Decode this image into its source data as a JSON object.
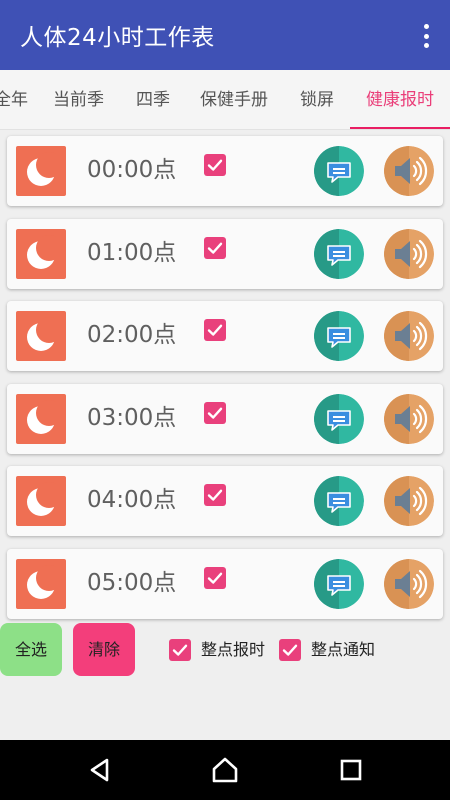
{
  "app_bar": {
    "title": "人体24小时工作表",
    "overflow_icon": "more-vert-icon",
    "background": "#3f51b5"
  },
  "tabs": [
    {
      "label": "全年",
      "active": false
    },
    {
      "label": "当前季",
      "active": false
    },
    {
      "label": "四季",
      "active": false
    },
    {
      "label": "保健手册",
      "active": false
    },
    {
      "label": "锁屏",
      "active": false
    },
    {
      "label": "健康报时",
      "active": true
    }
  ],
  "accent_color": "#e91e63",
  "alarms": [
    {
      "time": "00:00点",
      "checked": true,
      "icon": "moon-icon",
      "notify_icon": "message-icon",
      "sound_icon": "speaker-icon"
    },
    {
      "time": "01:00点",
      "checked": true,
      "icon": "moon-icon",
      "notify_icon": "message-icon",
      "sound_icon": "speaker-icon"
    },
    {
      "time": "02:00点",
      "checked": true,
      "icon": "moon-icon",
      "notify_icon": "message-icon",
      "sound_icon": "speaker-icon"
    },
    {
      "time": "03:00点",
      "checked": true,
      "icon": "moon-icon",
      "notify_icon": "message-icon",
      "sound_icon": "speaker-icon"
    },
    {
      "time": "04:00点",
      "checked": true,
      "icon": "moon-icon",
      "notify_icon": "message-icon",
      "sound_icon": "speaker-icon"
    },
    {
      "time": "05:00点",
      "checked": true,
      "icon": "moon-icon",
      "notify_icon": "message-icon",
      "sound_icon": "speaker-icon"
    }
  ],
  "bottom": {
    "select_all_label": "全选",
    "clear_label": "清除",
    "hourly_chime_label": "整点报时",
    "hourly_chime_checked": true,
    "hourly_notify_label": "整点通知",
    "hourly_notify_checked": true
  },
  "nav_bar": {
    "back_icon": "back-icon",
    "home_icon": "home-icon",
    "recents_icon": "recents-icon"
  }
}
